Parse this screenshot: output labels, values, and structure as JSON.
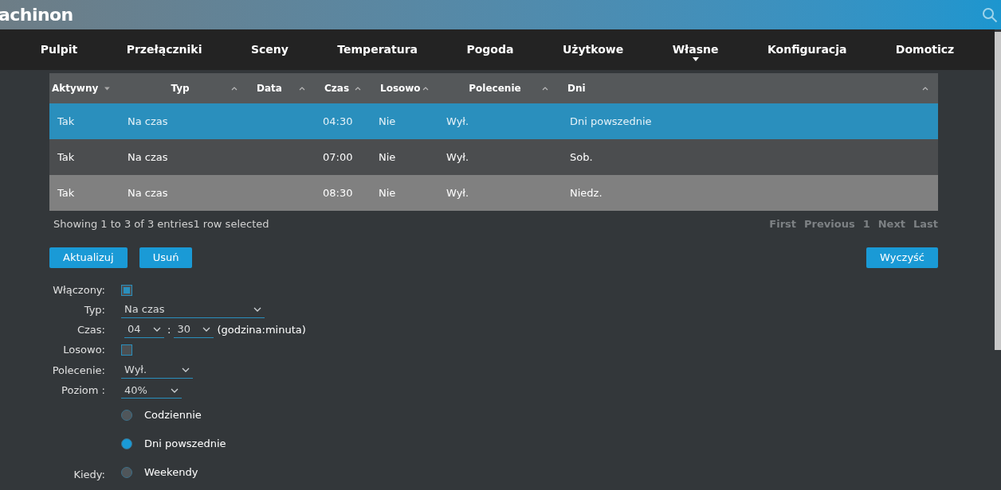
{
  "header": {
    "logo": "achinon"
  },
  "nav": [
    {
      "label": "Pulpit",
      "has_menu": false
    },
    {
      "label": "Przełączniki",
      "has_menu": false
    },
    {
      "label": "Sceny",
      "has_menu": false
    },
    {
      "label": "Temperatura",
      "has_menu": false
    },
    {
      "label": "Pogoda",
      "has_menu": false
    },
    {
      "label": "Użytkowe",
      "has_menu": false
    },
    {
      "label": "Własne",
      "has_menu": true
    },
    {
      "label": "Konfiguracja",
      "has_menu": false
    },
    {
      "label": "Domoticz",
      "has_menu": false
    }
  ],
  "table": {
    "columns": [
      {
        "label": "Aktywny",
        "sorted": true
      },
      {
        "label": "Typ",
        "sorted": false
      },
      {
        "label": "Data",
        "sorted": false
      },
      {
        "label": "Czas",
        "sorted": false
      },
      {
        "label": "Losowo",
        "sorted": false
      },
      {
        "label": "Polecenie",
        "sorted": false
      },
      {
        "label": "Dni",
        "sorted": false
      }
    ],
    "rows": [
      {
        "selected": true,
        "cells": [
          "Tak",
          "Na czas",
          "",
          "04:30",
          "Nie",
          "Wył.",
          "Dni powszednie"
        ]
      },
      {
        "selected": false,
        "cells": [
          "Tak",
          "Na czas",
          "",
          "07:00",
          "Nie",
          "Wył.",
          "Sob."
        ]
      },
      {
        "selected": false,
        "cells": [
          "Tak",
          "Na czas",
          "",
          "08:30",
          "Nie",
          "Wył.",
          "Niedz."
        ]
      }
    ],
    "info": "Showing 1 to 3 of 3 entries1 row selected",
    "pagination": [
      "First",
      "Previous",
      "1",
      "Next",
      "Last"
    ]
  },
  "buttons_left": [
    "Aktualizuj",
    "Usuń"
  ],
  "button_right": "Wyczyść",
  "form": {
    "enabled": {
      "label": "Włączony:",
      "checked": true
    },
    "type": {
      "label": "Typ:",
      "value": "Na czas"
    },
    "time": {
      "label": "Czas:",
      "hour": "04",
      "separator": ":",
      "minute": "30",
      "hint": "(godzina:minuta)"
    },
    "random": {
      "label": "Losowo:",
      "checked": false
    },
    "command": {
      "label": "Polecenie:",
      "value": "Wył."
    },
    "level": {
      "label": "Poziom :",
      "value": "40%"
    },
    "when": {
      "label": "Kiedy:",
      "options": [
        {
          "label": "Codziennie",
          "selected": false
        },
        {
          "label": "Dni powszednie",
          "selected": true
        },
        {
          "label": "Weekendy",
          "selected": false
        }
      ]
    }
  }
}
